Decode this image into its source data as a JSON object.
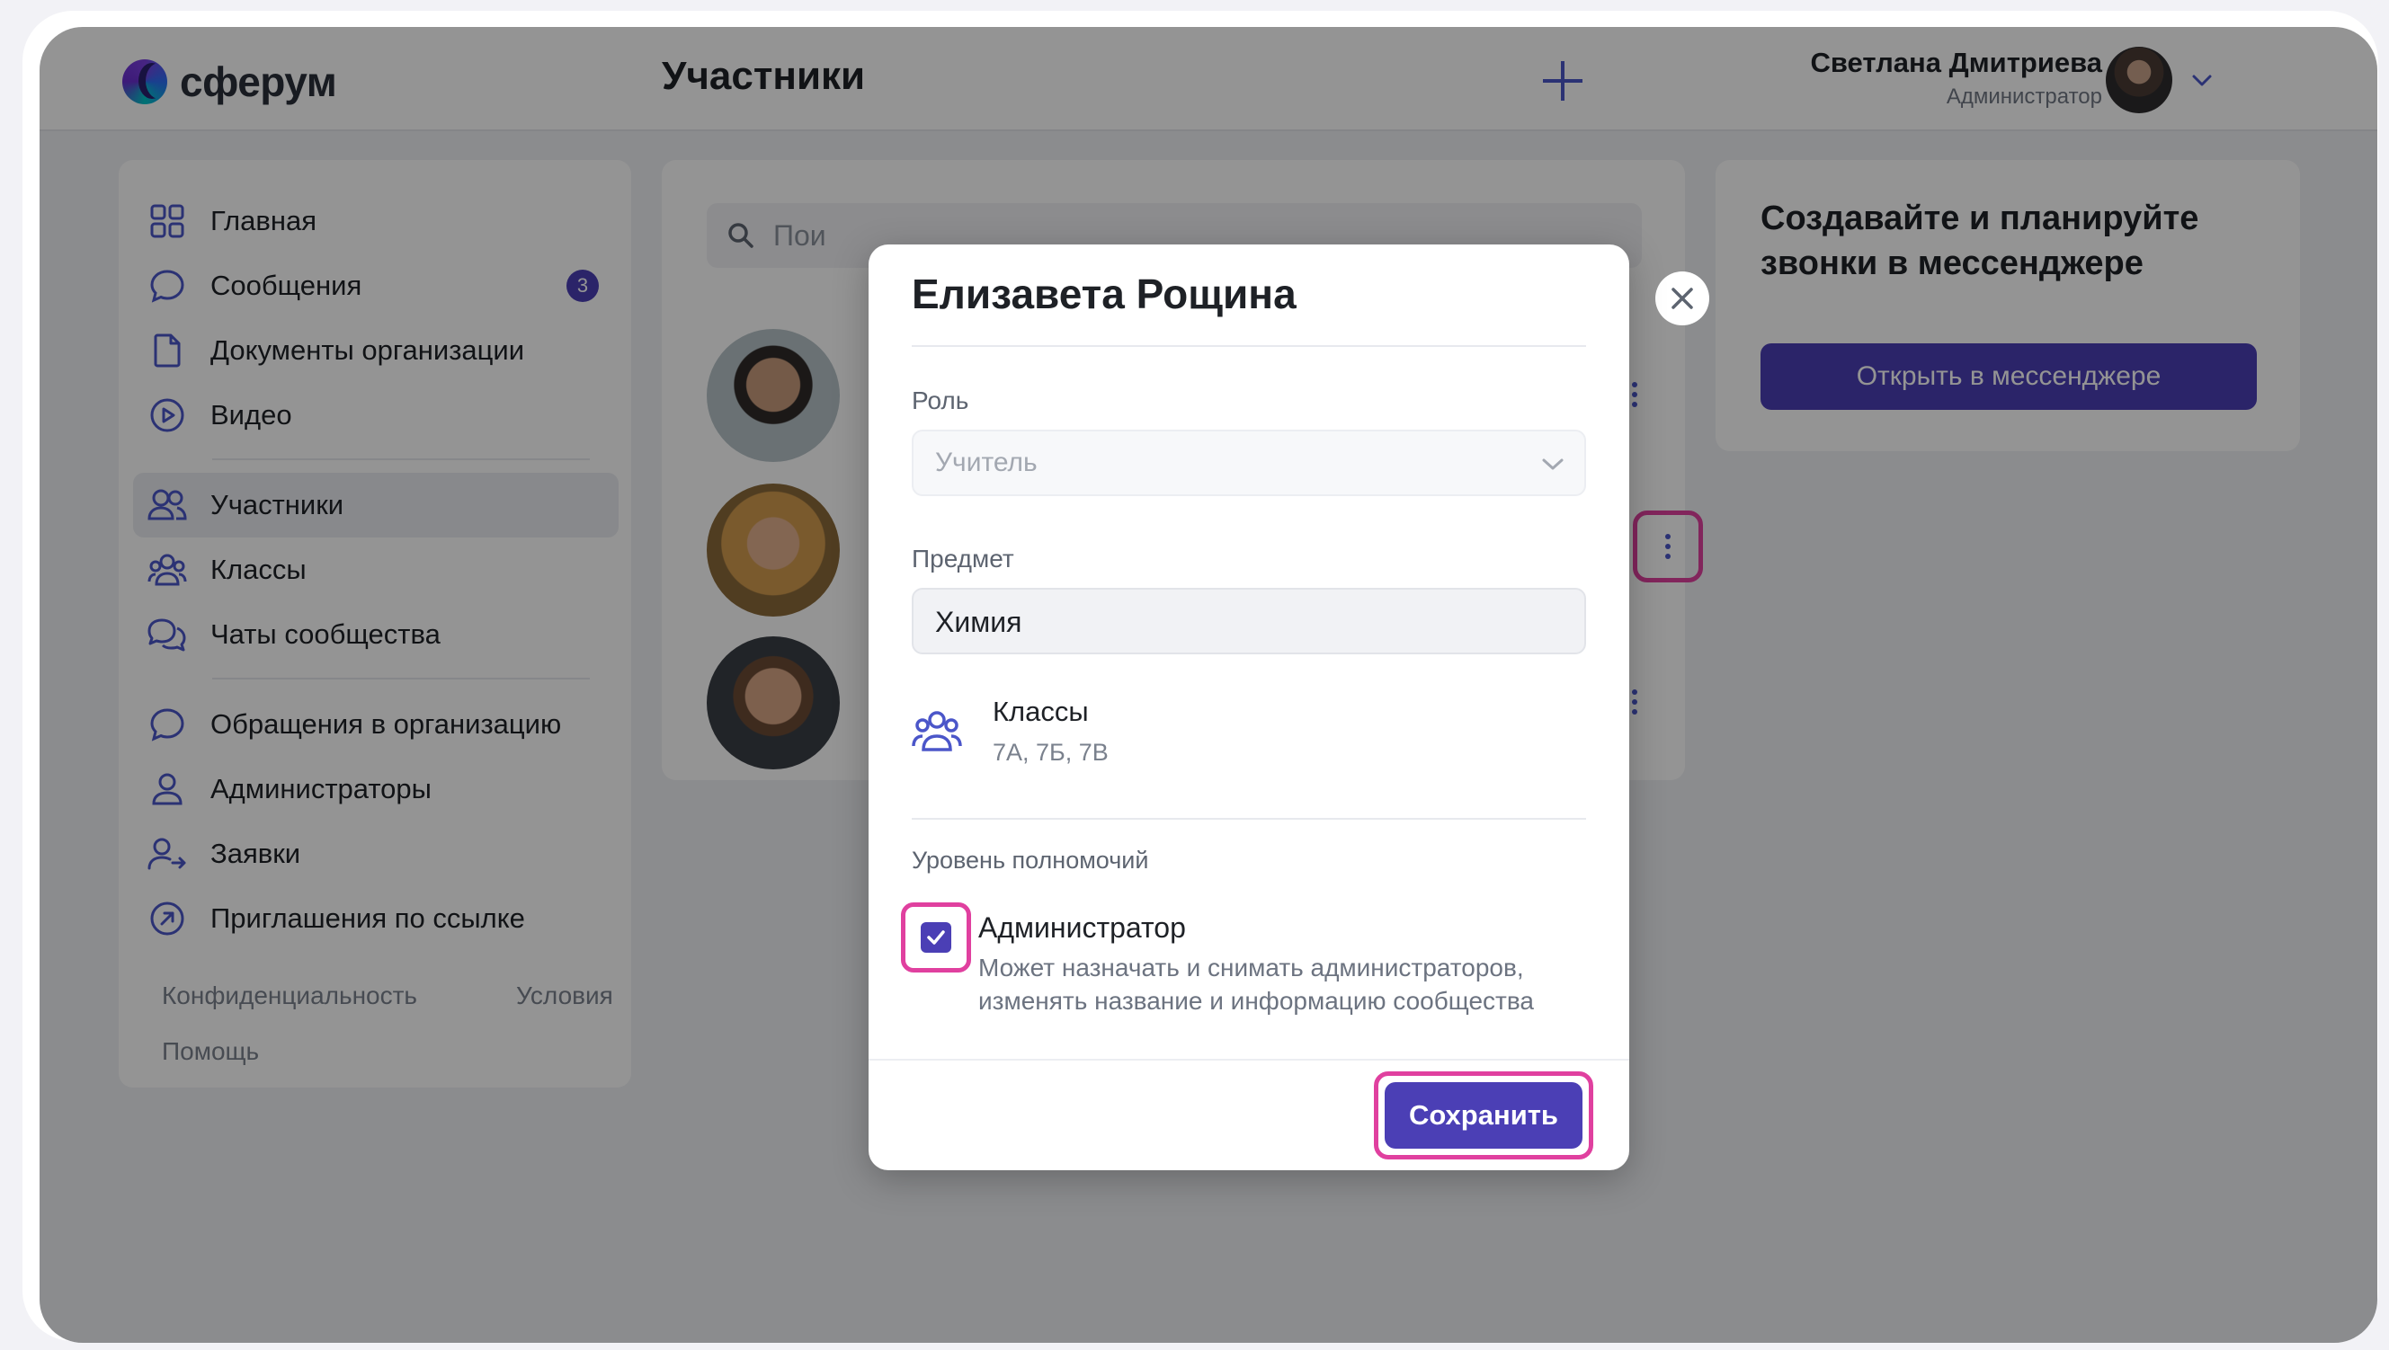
{
  "app": {
    "logo_text": "сферум",
    "page_title": "Участники"
  },
  "header": {
    "user_name": "Светлана Дмитриева",
    "user_role": "Администратор"
  },
  "sidebar": {
    "items": [
      {
        "label": "Главная",
        "icon": "grid-icon"
      },
      {
        "label": "Сообщения",
        "icon": "chat-icon",
        "badge": "3"
      },
      {
        "label": "Документы организации",
        "icon": "document-icon"
      },
      {
        "label": "Видео",
        "icon": "play-icon"
      },
      {
        "label": "Участники",
        "icon": "users-icon",
        "active": true
      },
      {
        "label": "Классы",
        "icon": "group-icon"
      },
      {
        "label": "Чаты сообщества",
        "icon": "chats-icon"
      },
      {
        "label": "Обращения в организацию",
        "icon": "chat-icon"
      },
      {
        "label": "Администраторы",
        "icon": "user-icon"
      },
      {
        "label": "Заявки",
        "icon": "user-arrow-icon"
      },
      {
        "label": "Приглашения по ссылке",
        "icon": "link-arrow-icon"
      }
    ],
    "footer": {
      "privacy": "Конфиденциальность",
      "terms": "Условия",
      "help": "Помощь"
    }
  },
  "members": {
    "search_placeholder": "Пои"
  },
  "promo": {
    "title": "Создавайте и планируйте звонки в мессенджере",
    "button": "Открыть в мессенджере"
  },
  "modal": {
    "title": "Елизавета Рощина",
    "role_label": "Роль",
    "role_value": "Учитель",
    "subject_label": "Предмет",
    "subject_value": "Химия",
    "classes_title": "Классы",
    "classes_value": "7А, 7Б, 7В",
    "permissions_label": "Уровень полномочий",
    "admin_title": "Администратор",
    "admin_desc": "Может назначать и снимать администраторов, изменять название и информацию сообщества",
    "admin_checked": true,
    "save": "Сохранить"
  },
  "colors": {
    "accent": "#4b3fb5",
    "highlight": "#e0409f"
  }
}
